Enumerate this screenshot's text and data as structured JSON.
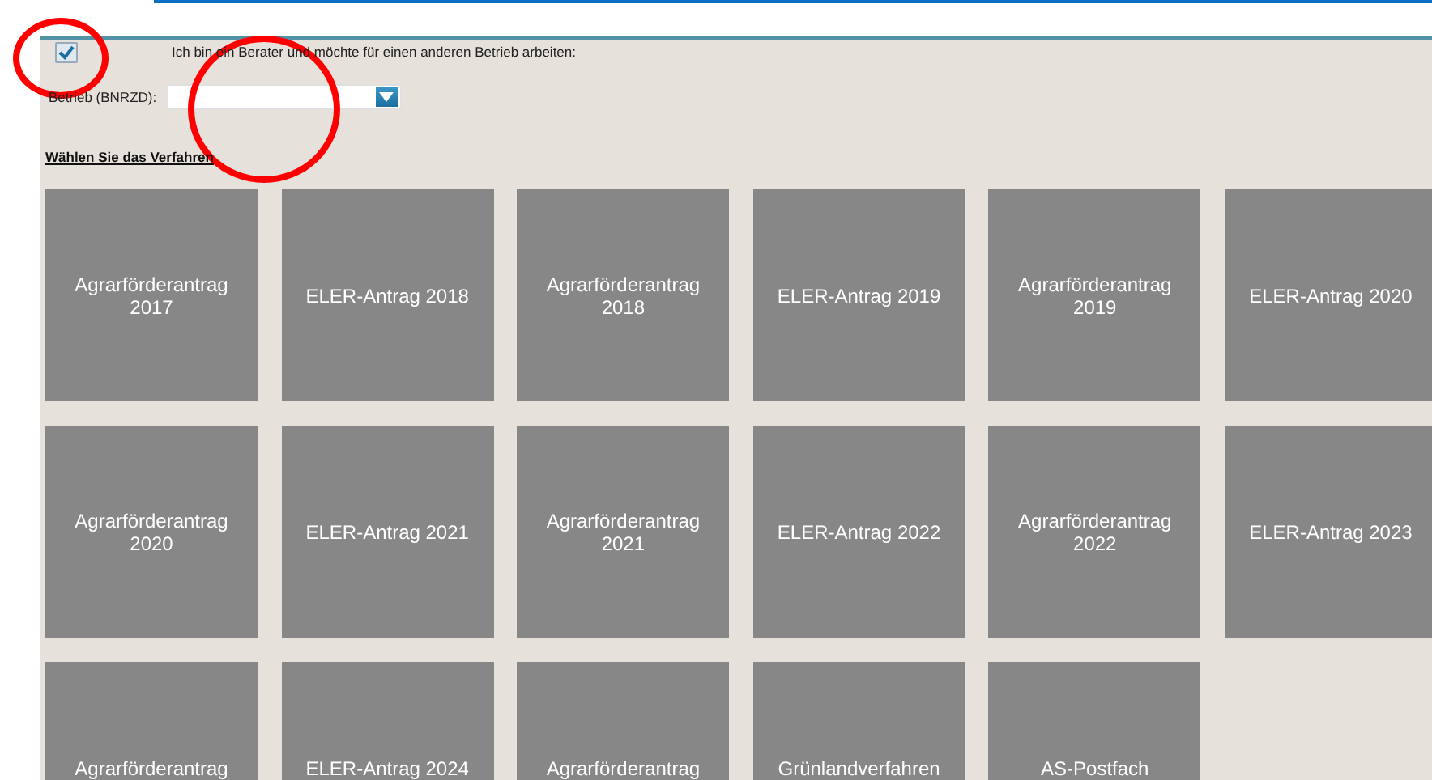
{
  "advisor_checkbox": {
    "label": "Ich bin ein Berater und möchte für einen anderen Betrieb arbeiten:",
    "checked": true
  },
  "betrieb_field": {
    "label": "Betrieb (BNRZD):"
  },
  "section_heading": "Wählen Sie das Verfahren",
  "tiles": [
    {
      "label": "Agrarförderantrag 2017"
    },
    {
      "label": "ELER-Antrag 2018"
    },
    {
      "label": "Agrarförderantrag 2018"
    },
    {
      "label": "ELER-Antrag 2019"
    },
    {
      "label": "Agrarförderantrag 2019"
    },
    {
      "label": "ELER-Antrag 2020"
    },
    {
      "label": "Agrarförderantrag 2020"
    },
    {
      "label": "ELER-Antrag 2021"
    },
    {
      "label": "Agrarförderantrag 2021"
    },
    {
      "label": "ELER-Antrag 2022"
    },
    {
      "label": "Agrarförderantrag 2022"
    },
    {
      "label": "ELER-Antrag 2023"
    },
    {
      "label": "Agrarförderantrag"
    },
    {
      "label": "ELER-Antrag 2024"
    },
    {
      "label": "Agrarförderantrag"
    },
    {
      "label": "Grünlandverfahren"
    },
    {
      "label": "AS-Postfach"
    }
  ]
}
